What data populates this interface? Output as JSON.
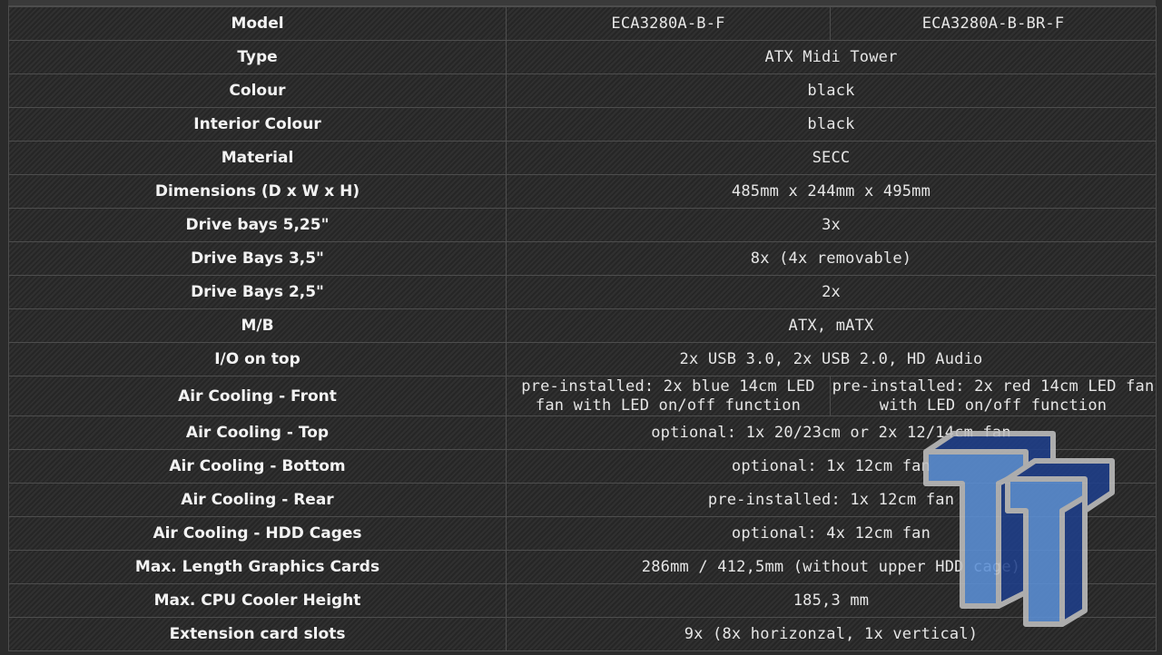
{
  "table": {
    "rows": [
      {
        "label": "Model",
        "cells": [
          "ECA3280A-B-F",
          "ECA3280A-B-BR-F"
        ]
      },
      {
        "label": "Type",
        "cells": [
          "ATX Midi Tower"
        ]
      },
      {
        "label": "Colour",
        "cells": [
          "black"
        ]
      },
      {
        "label": "Interior Colour",
        "cells": [
          "black"
        ]
      },
      {
        "label": "Material",
        "cells": [
          "SECC"
        ]
      },
      {
        "label": "Dimensions (D x W x H)",
        "cells": [
          "485mm x 244mm x 495mm"
        ]
      },
      {
        "label": "Drive bays 5,25\"",
        "cells": [
          "3x"
        ]
      },
      {
        "label": "Drive Bays 3,5\"",
        "cells": [
          "8x (4x removable)"
        ]
      },
      {
        "label": "Drive Bays 2,5\"",
        "cells": [
          "2x"
        ]
      },
      {
        "label": "M/B",
        "cells": [
          "ATX, mATX"
        ]
      },
      {
        "label": "I/O on top",
        "cells": [
          "2x USB 3.0, 2x USB 2.0, HD Audio"
        ]
      },
      {
        "label": "Air Cooling - Front",
        "cells": [
          "pre-installed: 2x blue 14cm LED fan with LED on/off function",
          "pre-installed: 2x red 14cm LED fan with LED on/off function"
        ]
      },
      {
        "label": "Air Cooling - Top",
        "cells": [
          "optional: 1x 20/23cm or 2x 12/14cm fan"
        ]
      },
      {
        "label": "Air Cooling - Bottom",
        "cells": [
          "optional: 1x 12cm fan"
        ]
      },
      {
        "label": "Air Cooling - Rear",
        "cells": [
          "pre-installed: 1x 12cm fan"
        ]
      },
      {
        "label": "Air Cooling - HDD Cages",
        "cells": [
          "optional: 4x 12cm fan"
        ]
      },
      {
        "label": "Max. Length Graphics Cards",
        "cells": [
          "286mm / 412,5mm (without upper HDD cage)"
        ]
      },
      {
        "label": "Max. CPU Cooler Height",
        "cells": [
          "185,3 mm"
        ]
      },
      {
        "label": "Extension card slots",
        "cells": [
          "9x (8x horizonzal, 1x vertical)"
        ]
      }
    ]
  },
  "logo": {
    "icon": "tt-watermark-icon",
    "face_color": "#5b8fd6",
    "side_color": "#1f3f8a",
    "outline_color": "#bfbfbf"
  }
}
